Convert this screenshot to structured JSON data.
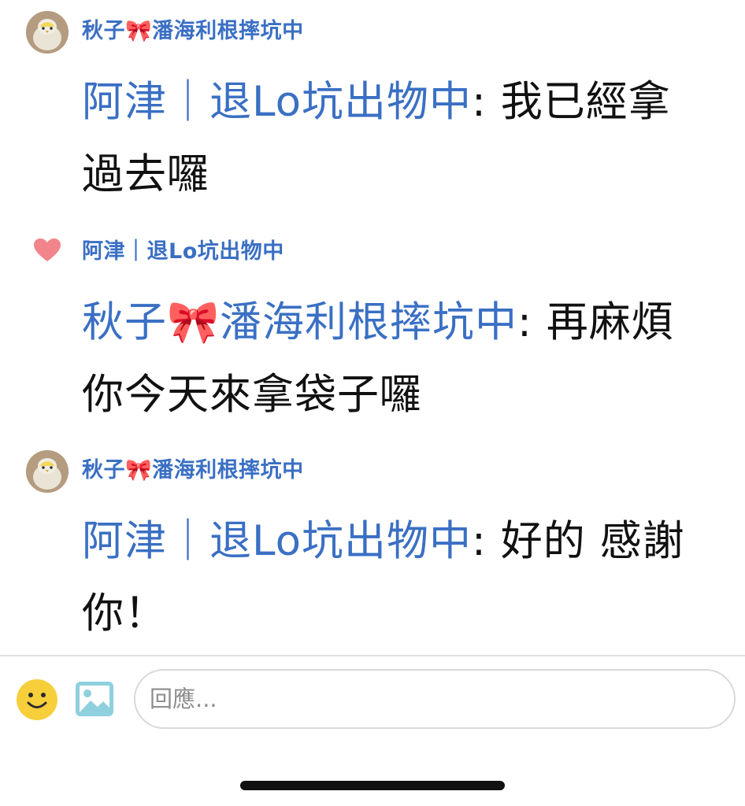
{
  "comments": [
    {
      "author": "秋子🎀潘海利根摔坑中",
      "mention": "阿津｜退Lo坑出物中",
      "separator": ": ",
      "text": "我已經拿過去囉",
      "avatar_icon": "bird-avatar"
    },
    {
      "author": "阿津｜退Lo坑出物中",
      "mention": "秋子🎀潘海利根摔坑中",
      "separator": ": ",
      "text": "再麻煩你今天來拿袋子囉",
      "avatar_icon": "heart-icon"
    },
    {
      "author": "秋子🎀潘海利根摔坑中",
      "mention": "阿津｜退Lo坑出物中",
      "separator": ": ",
      "text": "好的 感謝你！",
      "avatar_icon": "bird-avatar"
    }
  ],
  "composer": {
    "placeholder": "回應...",
    "emoji_icon": "smile-icon",
    "image_icon": "image-icon"
  },
  "colors": {
    "mention": "#3a6fc4",
    "heart": "#f2848c",
    "smile": "#f7cf3b",
    "image_icon": "#8fd0de"
  }
}
